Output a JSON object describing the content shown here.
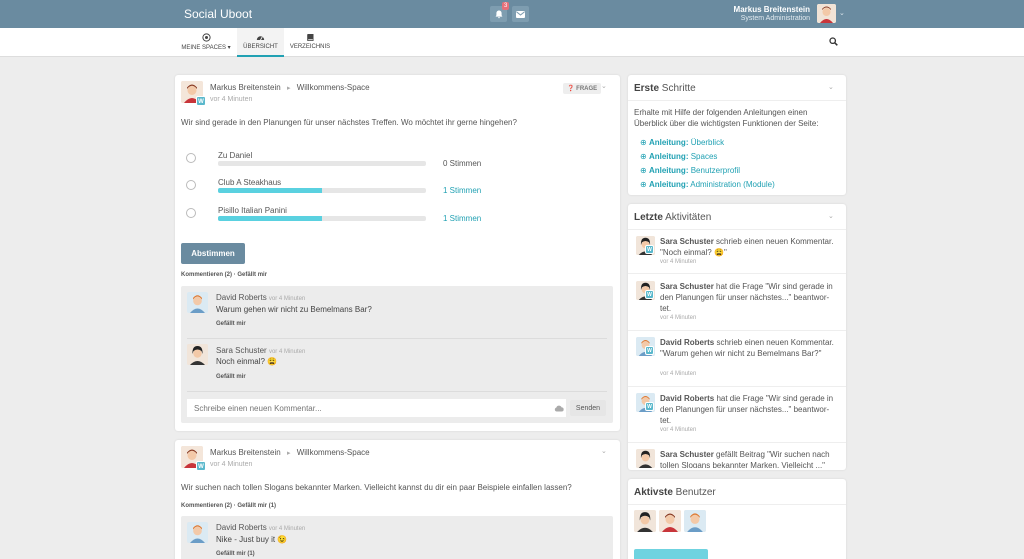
{
  "header": {
    "brand": "Social Uboot",
    "notification_count": "3",
    "user_name": "Markus Breitenstein",
    "user_role": "System Administration"
  },
  "nav": {
    "items": [
      {
        "label": "MEINE SPACES ▾"
      },
      {
        "label": "ÜBERSICHT"
      },
      {
        "label": "VERZEICHNIS"
      }
    ]
  },
  "post1": {
    "author": "Markus Breitenstein",
    "space": "Willkommens-Space",
    "time": "vor 4 Minuten",
    "badge": "FRAGE",
    "question": "Wir sind gerade in den Planungen für unser nächstes Treffen. Wo möchtet ihr gerne hingehen?",
    "options": [
      {
        "label": "Zu Daniel",
        "votes": "0 Stimmen",
        "share": 0
      },
      {
        "label": "Club A Steakhaus",
        "votes": "1 Stimmen",
        "share": 0.5
      },
      {
        "label": "Pisillo Italian Panini",
        "votes": "1 Stimmen",
        "share": 0.5
      }
    ],
    "vote_button": "Abstimmen",
    "comment_link": "Kommentieren (2)",
    "like_link": "Gefällt mir",
    "comments": [
      {
        "name": "David Roberts",
        "time": "vor 4 Minuten",
        "text": "Warum gehen wir nicht zu Bemelmans Bar?",
        "like": "Gefällt mir"
      },
      {
        "name": "Sara Schuster",
        "time": "vor 4 Minuten",
        "text": "Noch einmal? 😩",
        "like": "Gefällt mir"
      }
    ],
    "comment_placeholder": "Schreibe einen neuen Kommentar...",
    "send": "Senden"
  },
  "post2": {
    "author": "Markus Breitenstein",
    "space": "Willkommens-Space",
    "time": "vor 4 Minuten",
    "text": "Wir suchen nach tollen Slogans bekannter Marken. Vielleicht kannst du dir ein paar Beispiele einfallen lassen?",
    "comment_link": "Kommentieren (2)",
    "like_link": "Gefällt mir (1)",
    "comment": {
      "name": "David Roberts",
      "time": "vor 4 Minuten",
      "text": "Nike - Just buy it 😉",
      "like": "Gefällt mir (1)"
    }
  },
  "getting_started": {
    "title_bold": "Erste",
    "title_rest": " Schritte",
    "intro": "Erhalte mit Hilfe der folgenden Anleitungen einen Überblick über die wichtigsten Funktionen der Seite:",
    "guides": [
      {
        "prefix": "Anleitung:",
        "label": "Überblick"
      },
      {
        "prefix": "Anleitung:",
        "label": "Spaces"
      },
      {
        "prefix": "Anleitung:",
        "label": "Benutzerprofil"
      },
      {
        "prefix": "Anleitung:",
        "label": "Administration (Module)"
      }
    ]
  },
  "activities": {
    "title_bold": "Letzte",
    "title_rest": " Aktivitäten",
    "items": [
      {
        "name": "Sara Schuster",
        "text": " schrieb einen neuen Kommentar. \"Noch einmal? 😩\"",
        "time": "vor 4 Minuten"
      },
      {
        "name": "Sara Schuster",
        "text": " hat die Frage \"Wir sind gerade in den Planungen für unser nächstes...\" beantwor-tet.",
        "time": "vor 4 Minuten"
      },
      {
        "name": "David Roberts",
        "text": " schrieb einen neuen Kommentar. \"Warum gehen wir nicht zu Bemelmans Bar?\"",
        "time": "vor 4 Minuten"
      },
      {
        "name": "David Roberts",
        "text": " hat die Frage \"Wir sind gerade in den Planungen für unser nächstes...\" beantwor-tet.",
        "time": "vor 4 Minuten"
      },
      {
        "name": "Sara Schuster",
        "text": " gefällt Beitrag \"Wir suchen nach tollen Slogans bekannter Marken. Vielleicht ...\"",
        "time": ""
      }
    ]
  },
  "active_users": {
    "title_bold": "Aktivste",
    "title_rest": " Benutzer"
  },
  "colors": {
    "header": "#6a8ba0",
    "accent": "#21a1b3",
    "bar": "#5ad1e0"
  }
}
